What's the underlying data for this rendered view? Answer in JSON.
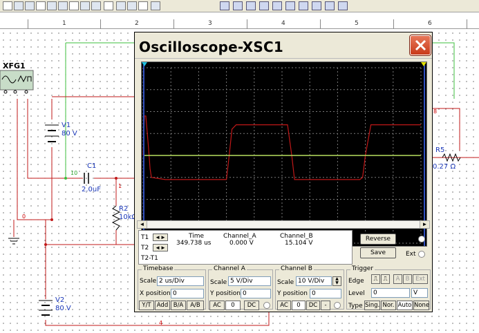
{
  "toolbar": {
    "icons": [
      "wire-icon",
      "diode-icon",
      "transistor-icon",
      "analog-icon",
      "ttl-icon",
      "cmos-icon",
      "misc-digital-icon",
      "mixed-icon",
      "indicator-icon",
      "misc-icon",
      "rf-icon",
      "electromech-icon",
      "msl-icon",
      "misc-icon-2"
    ],
    "msl_label": "MSL"
  },
  "ruler": {
    "numbers": [
      "1",
      "2",
      "3",
      "4",
      "5",
      "6"
    ]
  },
  "schematic": {
    "function_gen": "XFG1",
    "v1_name": "V1",
    "v1_value": "80 V",
    "c1_name": "C1",
    "c1_value": "2.0uF",
    "r2_name": "R2",
    "r2_value": "10kΩ",
    "r5_name": "R5",
    "r5_value": "0.27 Ω",
    "v2_name": "V2",
    "v2_value": "80 V",
    "net_10": "10",
    "net_1": "1",
    "net_0": "0",
    "net_8": "8",
    "net_4": "4",
    "colors": {
      "wire_red": "#c01818",
      "wire_green": "#3cbf3c",
      "label_blue": "#1a37b8"
    }
  },
  "oscilloscope": {
    "title": "Oscilloscope-XSC1",
    "close_icon": "close-icon",
    "readout": {
      "col_time": "Time",
      "col_a": "Channel_A",
      "col_b": "Channel_B",
      "t1_label": "T1",
      "t2_label": "T2",
      "t2t1_label": "T2-T1",
      "t1_time": "349.738 us",
      "t1_a": "0.000 V",
      "t1_b": "15.104 V"
    },
    "reverse_label": "Reverse",
    "save_label": "Save",
    "gnd_label": "GND",
    "ext_label": "Ext",
    "timebase": {
      "title": "Timebase",
      "scale_label": "Scale",
      "scale_value": "2 us/Div",
      "xpos_label": "X position",
      "xpos_value": "0",
      "btn_yt": "Y/T",
      "btn_add": "Add",
      "btn_ba": "B/A",
      "btn_ab": "A/B"
    },
    "channel_a": {
      "title": "Channel A",
      "scale_label": "Scale",
      "scale_value": "5  V/Div",
      "ypos_label": "Y position",
      "ypos_value": "0",
      "btn_ac": "AC",
      "btn_0": "0",
      "btn_dc": "DC"
    },
    "channel_b": {
      "title": "Channel B",
      "scale_label": "Scale",
      "scale_value": "10  V/Div",
      "ypos_label": "Y position",
      "ypos_value": "0",
      "btn_ac": "AC",
      "btn_0": "0",
      "btn_dc": "DC",
      "btn_minus": "-"
    },
    "trigger": {
      "title": "Trigger",
      "edge_label": "Edge",
      "btn_a": "A",
      "btn_b": "B",
      "btn_ext": "Ext",
      "level_label": "Level",
      "level_value": "0",
      "level_unit": "V",
      "type_label": "Type",
      "btn_sing": "Sing.",
      "btn_nor": "Nor.",
      "btn_auto": "Auto",
      "btn_none": "None"
    },
    "trace_colors": {
      "channel_a": "#c01818",
      "channel_b": "#b8e060",
      "grid": "#7a7a7a",
      "cursor_t1": "#20c0e0",
      "cursor_t2": "#e0e000"
    }
  },
  "chart_data": {
    "type": "line",
    "grid": true,
    "divisions_x": 10,
    "divisions_y": 8,
    "series": [
      {
        "x": [
          0,
          0.05,
          0.1,
          0.2,
          0.25,
          0.3,
          0.8,
          1.0,
          1.2,
          3.0,
          3.1,
          3.2,
          3.35,
          3.5,
          5.0,
          5.2,
          5.35,
          5.45,
          5.55,
          7.0,
          7.8,
          7.9,
          8.0,
          8.2,
          8.3,
          8.4,
          10
        ],
        "y": [
          0,
          1.8,
          1.8,
          0.3,
          -0.6,
          -1.0,
          -1.1,
          -1.1,
          -1.1,
          -1.1,
          0.0,
          1.2,
          1.4,
          1.4,
          1.4,
          1.4,
          0.0,
          -1.1,
          -1.1,
          -1.1,
          -1.1,
          -1.0,
          0.0,
          1.4,
          1.4,
          1.4,
          1.4
        ]
      },
      {
        "x": [
          0,
          10
        ],
        "y": [
          0,
          0
        ]
      }
    ]
  }
}
